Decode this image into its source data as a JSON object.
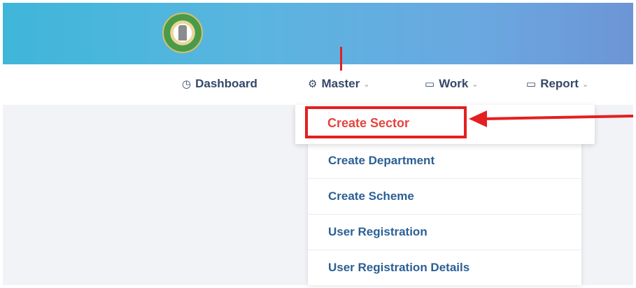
{
  "nav": {
    "dashboard": {
      "label": "Dashboard",
      "icon": "clock-icon"
    },
    "master": {
      "label": "Master",
      "icon": "gear-icon"
    },
    "work": {
      "label": "Work",
      "icon": "window-icon"
    },
    "report": {
      "label": "Report",
      "icon": "window-icon"
    }
  },
  "master_menu": {
    "items": [
      {
        "label": "Create Sector",
        "highlighted": true
      },
      {
        "label": "Create Department"
      },
      {
        "label": "Create Scheme"
      },
      {
        "label": "User Registration"
      },
      {
        "label": "User Registration Details"
      }
    ]
  },
  "colors": {
    "banner_start": "#3fb6d9",
    "banner_end": "#6d95d6",
    "nav_text": "#34486a",
    "menu_text": "#2b5f95",
    "highlight": "#e41f1f",
    "active_item": "#e2453e"
  }
}
